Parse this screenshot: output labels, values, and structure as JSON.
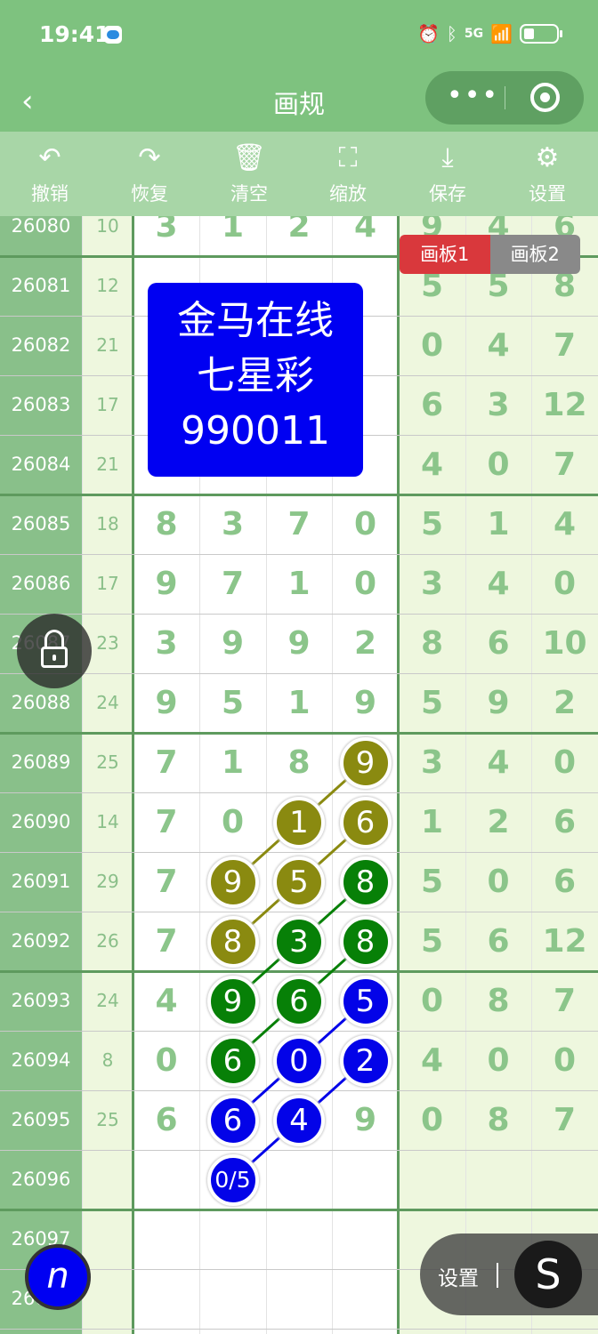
{
  "status_bar": {
    "time": "19:41",
    "network": "5G"
  },
  "nav": {
    "back_icon": "chevron-left-icon",
    "title": "画规",
    "more_icon": "more-dots-icon",
    "close_icon": "target-icon"
  },
  "toolbar": [
    {
      "id": "undo",
      "label": "撤销",
      "icon": "undo-icon",
      "glyph": "↶"
    },
    {
      "id": "redo",
      "label": "恢复",
      "icon": "redo-icon",
      "glyph": "↷"
    },
    {
      "id": "clear",
      "label": "清空",
      "icon": "trash-icon",
      "glyph": "🗑"
    },
    {
      "id": "zoom",
      "label": "缩放",
      "icon": "zoom-icon",
      "glyph": "⛶"
    },
    {
      "id": "save",
      "label": "保存",
      "icon": "download-icon",
      "glyph": "⤓"
    },
    {
      "id": "settings",
      "label": "设置",
      "icon": "gear-icon",
      "glyph": "⚙"
    }
  ],
  "board_tabs": [
    "画板1",
    "画板2"
  ],
  "ad_box": [
    "金马在线",
    "七星彩",
    "990011"
  ],
  "rows": [
    {
      "issue": "26080",
      "sum": "10",
      "digits": [
        "3",
        "1",
        "2",
        "4",
        "9",
        "4",
        "6"
      ]
    },
    {
      "issue": "26081",
      "sum": "12",
      "digits": [
        "",
        "",
        "",
        "",
        "5",
        "5",
        "8"
      ]
    },
    {
      "issue": "26082",
      "sum": "21",
      "digits": [
        "",
        "",
        "",
        "",
        "0",
        "4",
        "7"
      ]
    },
    {
      "issue": "26083",
      "sum": "17",
      "digits": [
        "",
        "",
        "",
        "",
        "6",
        "3",
        "12"
      ]
    },
    {
      "issue": "26084",
      "sum": "21",
      "digits": [
        "",
        "",
        "",
        "",
        "4",
        "0",
        "7"
      ]
    },
    {
      "issue": "26085",
      "sum": "18",
      "digits": [
        "8",
        "3",
        "7",
        "0",
        "5",
        "1",
        "4"
      ]
    },
    {
      "issue": "26086",
      "sum": "17",
      "digits": [
        "9",
        "7",
        "1",
        "0",
        "3",
        "4",
        "0"
      ]
    },
    {
      "issue": "26087",
      "sum": "23",
      "digits": [
        "3",
        "9",
        "9",
        "2",
        "8",
        "6",
        "10"
      ]
    },
    {
      "issue": "26088",
      "sum": "24",
      "digits": [
        "9",
        "5",
        "1",
        "9",
        "5",
        "9",
        "2"
      ]
    },
    {
      "issue": "26089",
      "sum": "25",
      "digits": [
        "7",
        "1",
        "8",
        "9",
        "3",
        "4",
        "0"
      ]
    },
    {
      "issue": "26090",
      "sum": "14",
      "digits": [
        "7",
        "0",
        "1",
        "6",
        "1",
        "2",
        "6"
      ]
    },
    {
      "issue": "26091",
      "sum": "29",
      "digits": [
        "7",
        "9",
        "5",
        "8",
        "5",
        "0",
        "6"
      ]
    },
    {
      "issue": "26092",
      "sum": "26",
      "digits": [
        "7",
        "8",
        "3",
        "8",
        "5",
        "6",
        "12"
      ]
    },
    {
      "issue": "26093",
      "sum": "24",
      "digits": [
        "4",
        "9",
        "6",
        "5",
        "0",
        "8",
        "7"
      ]
    },
    {
      "issue": "26094",
      "sum": "8",
      "digits": [
        "0",
        "6",
        "0",
        "2",
        "4",
        "0",
        "0"
      ]
    },
    {
      "issue": "26095",
      "sum": "25",
      "digits": [
        "6",
        "6",
        "4",
        "9",
        "0",
        "8",
        "7"
      ]
    },
    {
      "issue": "26096",
      "sum": "",
      "digits": [
        "",
        "",
        "",
        "",
        "",
        "",
        ""
      ]
    },
    {
      "issue": "26097",
      "sum": "",
      "digits": [
        "",
        "",
        "",
        "",
        "",
        "",
        ""
      ]
    },
    {
      "issue": "26098",
      "sum": "",
      "digits": [
        "",
        "",
        "",
        "",
        "",
        "",
        ""
      ]
    }
  ],
  "marked_balls": [
    {
      "row": 9,
      "col": 3,
      "value": "9",
      "color": "#8a8a10"
    },
    {
      "row": 10,
      "col": 2,
      "value": "1",
      "color": "#8a8a10"
    },
    {
      "row": 10,
      "col": 3,
      "value": "6",
      "color": "#8a8a10"
    },
    {
      "row": 11,
      "col": 1,
      "value": "9",
      "color": "#8a8a10"
    },
    {
      "row": 11,
      "col": 2,
      "value": "5",
      "color": "#8a8a10"
    },
    {
      "row": 11,
      "col": 3,
      "value": "8",
      "color": "#078007"
    },
    {
      "row": 12,
      "col": 1,
      "value": "8",
      "color": "#8a8a10"
    },
    {
      "row": 12,
      "col": 2,
      "value": "3",
      "color": "#078007"
    },
    {
      "row": 12,
      "col": 3,
      "value": "8",
      "color": "#078007"
    },
    {
      "row": 13,
      "col": 1,
      "value": "9",
      "color": "#078007"
    },
    {
      "row": 13,
      "col": 2,
      "value": "6",
      "color": "#078007"
    },
    {
      "row": 13,
      "col": 3,
      "value": "5",
      "color": "#0303e8"
    },
    {
      "row": 14,
      "col": 1,
      "value": "6",
      "color": "#078007"
    },
    {
      "row": 14,
      "col": 2,
      "value": "0",
      "color": "#0303e8"
    },
    {
      "row": 14,
      "col": 3,
      "value": "2",
      "color": "#0303e8"
    },
    {
      "row": 15,
      "col": 1,
      "value": "6",
      "color": "#0303e8"
    },
    {
      "row": 15,
      "col": 2,
      "value": "4",
      "color": "#0303e8"
    },
    {
      "row": 16,
      "col": 1,
      "value": "0/5",
      "color": "#0303e8"
    }
  ],
  "chains": [
    {
      "color": "#8a8a10",
      "points": [
        [
          9,
          3
        ],
        [
          10,
          2
        ],
        [
          11,
          1
        ]
      ]
    },
    {
      "color": "#8a8a10",
      "points": [
        [
          10,
          3
        ],
        [
          11,
          2
        ],
        [
          12,
          1
        ]
      ]
    },
    {
      "color": "#078007",
      "points": [
        [
          11,
          3
        ],
        [
          12,
          2
        ],
        [
          13,
          1
        ]
      ]
    },
    {
      "color": "#078007",
      "points": [
        [
          12,
          3
        ],
        [
          13,
          2
        ],
        [
          14,
          1
        ]
      ]
    },
    {
      "color": "#0303e8",
      "points": [
        [
          13,
          3
        ],
        [
          14,
          2
        ],
        [
          15,
          1
        ]
      ]
    },
    {
      "color": "#0303e8",
      "points": [
        [
          14,
          3
        ],
        [
          15,
          2
        ],
        [
          16,
          1
        ]
      ]
    }
  ],
  "settings_pill": {
    "label": "设置",
    "s_glyph": "S"
  },
  "pen_glyph": "n",
  "colors": {
    "header": "#7ec27f",
    "toolbar": "#a8d6a7",
    "issue_col": "#89c08a",
    "tab_active": "#d9383c",
    "ad_bg": "#0000f2"
  }
}
